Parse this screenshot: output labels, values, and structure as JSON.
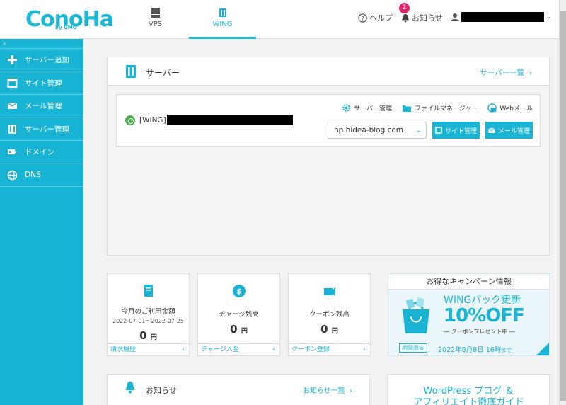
{
  "header": {
    "logo": "ConoHa",
    "logo_sub": "by GMO",
    "nav": [
      {
        "label": "VPS"
      },
      {
        "label": "WING"
      }
    ],
    "help": "ヘルプ",
    "notice": "お知らせ",
    "notice_count": "2"
  },
  "sidebar": {
    "collapse": "‹",
    "items": [
      {
        "label": "サーバー追加",
        "icon": "plus-icon"
      },
      {
        "label": "サイト管理",
        "icon": "window-icon"
      },
      {
        "label": "メール管理",
        "icon": "mail-icon"
      },
      {
        "label": "サーバー管理",
        "icon": "server-icon"
      },
      {
        "label": "ドメイン",
        "icon": "domain-icon"
      },
      {
        "label": "DNS",
        "icon": "globe-icon"
      }
    ]
  },
  "server": {
    "title": "サーバー",
    "list_link": "サーバー一覧",
    "tag": "[WING]",
    "links": {
      "manage": "サーバー管理",
      "files": "ファイルマネージャー",
      "webmail": "Webメール"
    },
    "domain": "hp.hidea-blog.com",
    "btn_site": "サイト管理",
    "btn_mail": "メール管理"
  },
  "stats": [
    {
      "label": "今月のご利用金額",
      "sub": "2022-07-01～2022-07-25",
      "amount": "0",
      "unit": "円",
      "foot": "請求履歴"
    },
    {
      "label": "チャージ残高",
      "sub": "",
      "amount": "0",
      "unit": "円",
      "foot": "チャージ入金"
    },
    {
      "label": "クーポン残高",
      "sub": "",
      "amount": "0",
      "unit": "円",
      "foot": "クーポン登録"
    }
  ],
  "campaign": {
    "head": "お得なキャンペーン情報",
    "title": "WINGパック更新",
    "off": "10%OFF",
    "present": "― クーポンプレゼント中 ―",
    "limit": "期間限定",
    "date": "2022年8月8日 16時",
    "date_suffix": "まで"
  },
  "news": {
    "title": "お知らせ",
    "link": "お知らせ一覧"
  },
  "wp_banner": {
    "line1": "WordPress ブログ ＆",
    "line2": "アフィリエイト徹底ガイド"
  },
  "colors": {
    "accent": "#19b4d4",
    "badge": "#e6246e"
  }
}
